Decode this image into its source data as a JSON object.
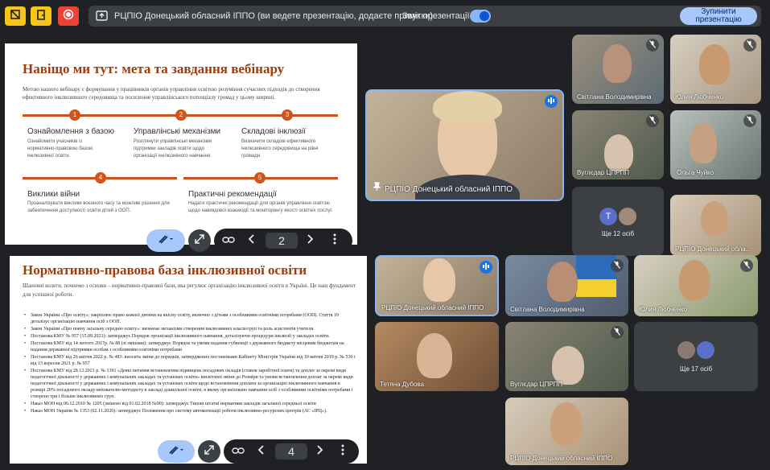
{
  "topbar": {
    "presentation_title": "РЦПІО Донецький обласний ІППО (ви ведете презентацію, додаєте примітки)",
    "sound_label": "Звук презентації",
    "stop_line1": "Зупинити",
    "stop_line2": "презентацію"
  },
  "slide1": {
    "title": "Навіщо ми тут: мета та завдання вебінару",
    "intro": "Метою нашого вебінару є формування у працівників органів управління освітою розуміння сучасних підходів до створення ефективного інклюзивного середовища та посилення управлінського потенціалу громад у цьому ширині.",
    "steps": [
      {
        "num": "1",
        "title": "Ознайомлення з базою",
        "desc": "Ознайомити учасників із нормативно-правовою базою інклюзивної освіти."
      },
      {
        "num": "2",
        "title": "Управлінські механізми",
        "desc": "Розглянути управлінські механізми підтримки закладів освіти щодо організації інклюзивного навчання."
      },
      {
        "num": "3",
        "title": "Складові інклюзії",
        "desc": "Визначити складові ефективного інклюзивного середовища на рівні громади."
      },
      {
        "num": "4",
        "title": "Виклики війни",
        "desc": "Проаналізувати виклики воєнного часу та можливі рішення для забезпечення доступності освіти дітей з ООП."
      },
      {
        "num": "5",
        "title": "Практичні рекомендації",
        "desc": "Надати практичні рекомендації для органів управління освітою щодо навякдової взаємодії та моніторингу якості освітніх послуг."
      }
    ],
    "page": "2"
  },
  "slide2": {
    "title": "Нормативно-правова база інклюзивної освіти",
    "intro": "Шановні колеги, почнемо з основи – нормативно-правової бази, яка регулює організацію інклюзивної освіти в Україні. Це наш фундамент для успішної роботи.",
    "bullets": [
      "Закон України «Про освіту»: закріплює право кожної дитини на якісну освіту, включно з дітьми з особливими освітніми потребами (ООП). Стаття 19 деталізує організацію навчання осіб з ООП.",
      "Закон України «Про повну загальну середню освіту»: визначає механізми створення інклюзивних класів/груп та роль асистентів учителя.",
      "Постанова КМУ № 957 (15.09.2021): затверджує Порядок організації інклюзивного навчання, деталізуючи процедури інклюзії у закладах освіти.",
      "Постанова КМУ від 14 лютого 2017р. № 88 (зі змінами): затверджує Порядок та умови надання субвенції з державного бюджету місцевим бюджетам на надання державної підтримки особам з особливими освітніми потребами",
      "Постанова КМУ від 26 квітня 2022 р. № 483: вносить зміни до порядків, затверджених постановами Кабінету Міністрів України від 10 квітня 2019 р. № 530 і від 15 вересня 2021 р. № 957",
      "Постанова КМУ від 28.12.2021 р. № 1391 «Деякі питання встановлення підвищень посадових окладів (ставок заробітної плати) та доплат за окремі види педагогічної діяльності у державних і комунальних закладах та установах освіти» висвітлені зміни до Розміри та умови встановлення доплат за окремі види педагогічної діяльності у державних і комунальних закладах та установах освіти щодо встановлення доплати за організацію інклюзивного навчання в розмірі 20% посадового окладу вихователю-методисту в закладі дошкільної освіти, в якому організовано навчання осіб з особливими освітніми потребами і створено три і більше інклюзивних груп.",
      "Наказ МОН від 06.12.2010 № 1205 (змінено від 01.02.2018 №90): затверджує Типові штатні нормативи закладів загальної середньої освіти",
      "Наказ МОН України № 1353 (02.11.2020): затверджує Положення про систему автоматизації роботи інклюзивно-ресурсних центрів (АС «ІРЦ»)."
    ],
    "page": "4"
  },
  "featured": {
    "name": "РЦПІО Донецький обласний ІППО"
  },
  "participants_right": [
    {
      "name": "Світлана Володимирівна"
    },
    {
      "name": "Юлия Любченко"
    },
    {
      "name": "Вуглєдар ЦПРПП"
    },
    {
      "name": "Ольга Чуйко"
    },
    {
      "name": "Ще 12 осіб",
      "avatar_letter": "Т"
    },
    {
      "name": "РЦПІО Донецький обла..."
    }
  ],
  "participants_bottom": [
    {
      "name": "РЦПІО Донецький обласний ІППО"
    },
    {
      "name": "Світлана Володимирівна"
    },
    {
      "name": "Юлия Любченко"
    },
    {
      "name": "Тетяна Дубова"
    },
    {
      "name": "Вуглєдар ЦПРПП"
    },
    {
      "name": "Ще 17 осіб"
    },
    {
      "name": "РЦПІО Донецький обласний ІППО"
    }
  ],
  "colors": {
    "accent": "#c9531e",
    "title": "#9c3d0e",
    "bar": "#202124",
    "highlight": "#8ab4f8"
  },
  "icons": [
    "hand-icon",
    "door-icon",
    "record-icon",
    "present-icon",
    "pen-icon",
    "expand-icon",
    "link-icon",
    "chevron-left-icon",
    "chevron-right-icon",
    "more-icon",
    "mic-off-icon",
    "pin-icon",
    "speaking-icon"
  ]
}
